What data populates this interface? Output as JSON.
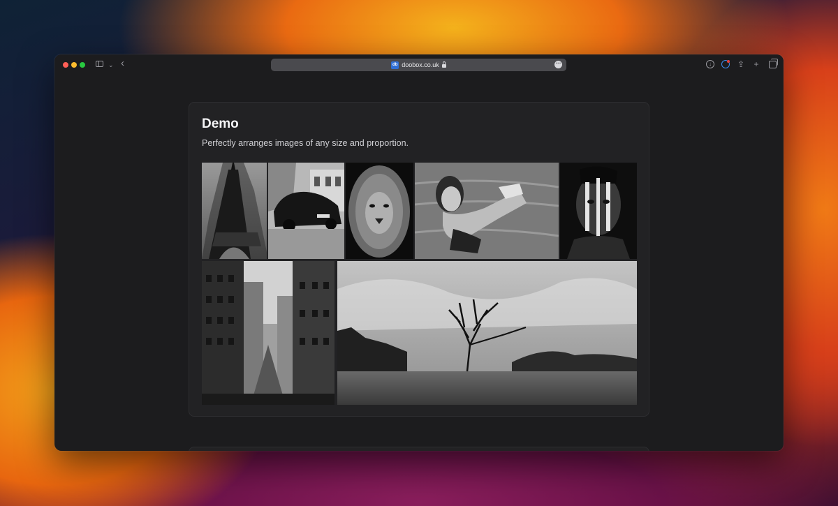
{
  "browser": {
    "url": "doobox.co.uk",
    "favicon_text": "db",
    "traffic_lights": {
      "close": "#ff5f57",
      "minimize": "#febc2e",
      "zoom": "#28c840"
    },
    "icons": [
      "sidebar-icon",
      "chevron-down-icon",
      "back-icon",
      "lock-icon",
      "more-icon",
      "download-icon",
      "extension-icon",
      "share-icon",
      "new-tab-icon",
      "tab-overview-icon"
    ]
  },
  "demo": {
    "title": "Demo",
    "description": "Perfectly arranges images of any size and proportion.",
    "gallery": [
      {
        "subject": "eiffel-tower"
      },
      {
        "subject": "classic-car"
      },
      {
        "subject": "lion"
      },
      {
        "subject": "woman-in-water"
      },
      {
        "subject": "face-paint-portrait"
      },
      {
        "subject": "city-skyscrapers"
      },
      {
        "subject": "lone-tree-lake"
      }
    ]
  }
}
